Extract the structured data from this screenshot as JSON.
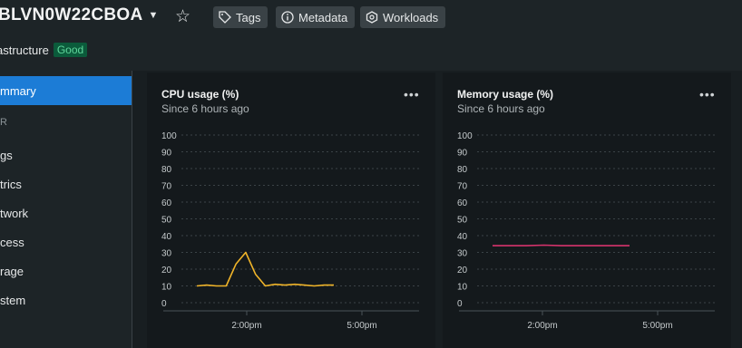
{
  "header": {
    "title": "BLVN0W22CBOA",
    "tags_label": "Tags",
    "metadata_label": "Metadata",
    "workloads_label": "Workloads",
    "subtitle": "astructure",
    "status_badge": "Good"
  },
  "sidebar": {
    "items": [
      {
        "label": "mmary",
        "active": true
      },
      {
        "label": "R",
        "muted": true
      },
      {
        "label": "gs"
      },
      {
        "label": "trics"
      },
      {
        "label": "twork"
      },
      {
        "label": "cess"
      },
      {
        "label": "rage"
      },
      {
        "label": "stem"
      }
    ]
  },
  "cards": [
    {
      "title": "CPU usage (%)",
      "subtitle": "Since 6 hours ago",
      "menu": "..."
    },
    {
      "title": "Memory usage (%)",
      "subtitle": "Since 6 hours ago",
      "menu": "..."
    }
  ],
  "colors": {
    "accent": "#1c7cd6",
    "cpu_line": "#f0b429",
    "memory_line": "#d6336c",
    "badge_bg": "#0b5b3b",
    "badge_text": "#5fd69b"
  },
  "chart_data": [
    {
      "type": "line",
      "title": "CPU usage (%)",
      "subtitle": "Since 6 hours ago",
      "yticks": [
        100,
        90,
        80,
        70,
        60,
        50,
        40,
        30,
        20,
        10,
        0
      ],
      "ylim": [
        0,
        100
      ],
      "xtick_labels": [
        "2:00pm",
        "5:00pm"
      ],
      "grid": true,
      "series": [
        {
          "values": [
            10,
            10.5,
            10,
            10,
            23,
            30,
            17,
            10,
            11,
            10.5,
            11,
            10.5,
            10,
            10.5,
            10.5
          ]
        }
      ]
    },
    {
      "type": "line",
      "title": "Memory usage (%)",
      "subtitle": "Since 6 hours ago",
      "yticks": [
        100,
        90,
        80,
        70,
        60,
        50,
        40,
        30,
        20,
        10,
        0
      ],
      "ylim": [
        0,
        100
      ],
      "xtick_labels": [
        "2:00pm",
        "5:00pm"
      ],
      "grid": true,
      "series": [
        {
          "values": [
            34,
            34,
            34,
            34.3,
            34,
            34,
            34,
            34,
            34
          ]
        }
      ]
    }
  ]
}
